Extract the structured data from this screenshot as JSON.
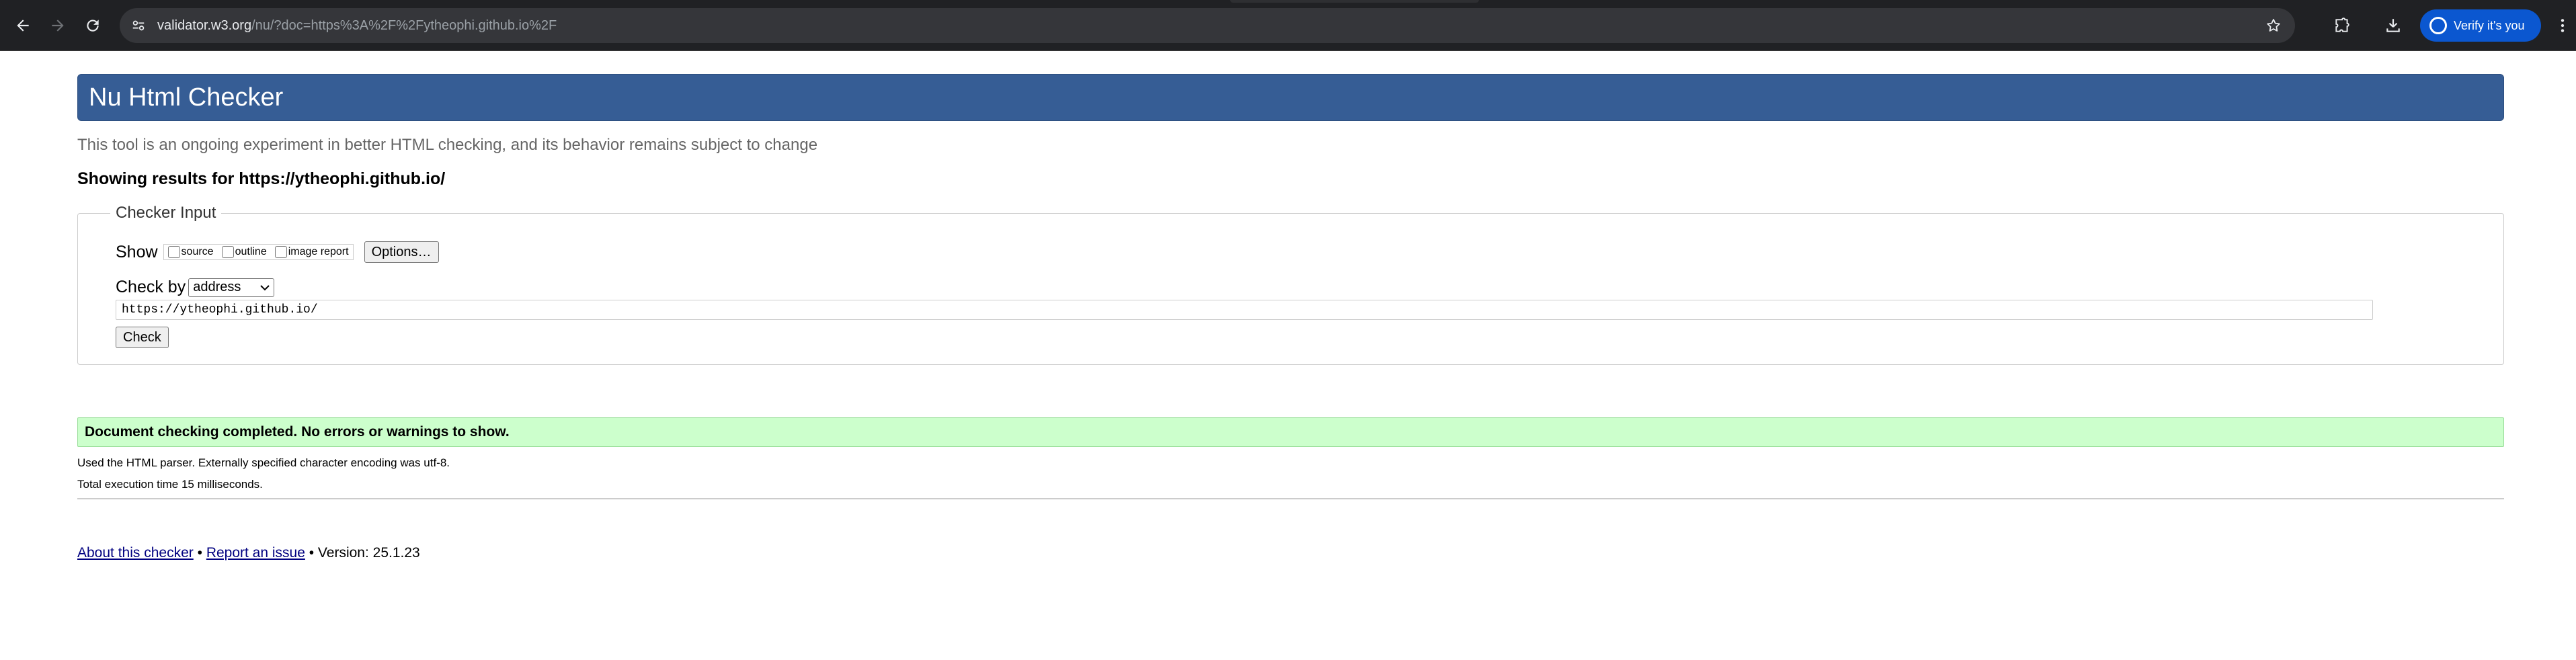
{
  "browser": {
    "url_host": "validator.w3.org",
    "url_rest": "/nu/?doc=https%3A%2F%2Fytheophi.github.io%2F",
    "verify_label": "Verify it's you"
  },
  "page": {
    "header_title": "Nu Html Checker",
    "intro": "This tool is an ongoing experiment in better HTML checking, and its behavior remains subject to change",
    "results_for": "Showing results for https://ytheophi.github.io/",
    "checker_input": {
      "legend": "Checker Input",
      "show_label": "Show",
      "options": [
        {
          "label": "source",
          "checked": false
        },
        {
          "label": "outline",
          "checked": false
        },
        {
          "label": "image report",
          "checked": false
        }
      ],
      "options_button": "Options…",
      "check_by_label": "Check by",
      "check_by_value": "address",
      "url_value": "https://ytheophi.github.io/",
      "check_button": "Check"
    },
    "result": {
      "success_message": "Document checking completed. No errors or warnings to show.",
      "parser_info": "Used the HTML parser. Externally specified character encoding was utf-8.",
      "execution_time": "Total execution time 15 milliseconds."
    },
    "footer": {
      "about_link": "About this checker",
      "separator": "•",
      "report_link": "Report an issue",
      "version": "• Version: 25.1.23"
    }
  },
  "colors": {
    "header_bg": "#365d95",
    "success_bg": "#ccffcc",
    "link": "#000080",
    "browser_bg": "#202124",
    "verify_chip": "#0b57d0"
  }
}
